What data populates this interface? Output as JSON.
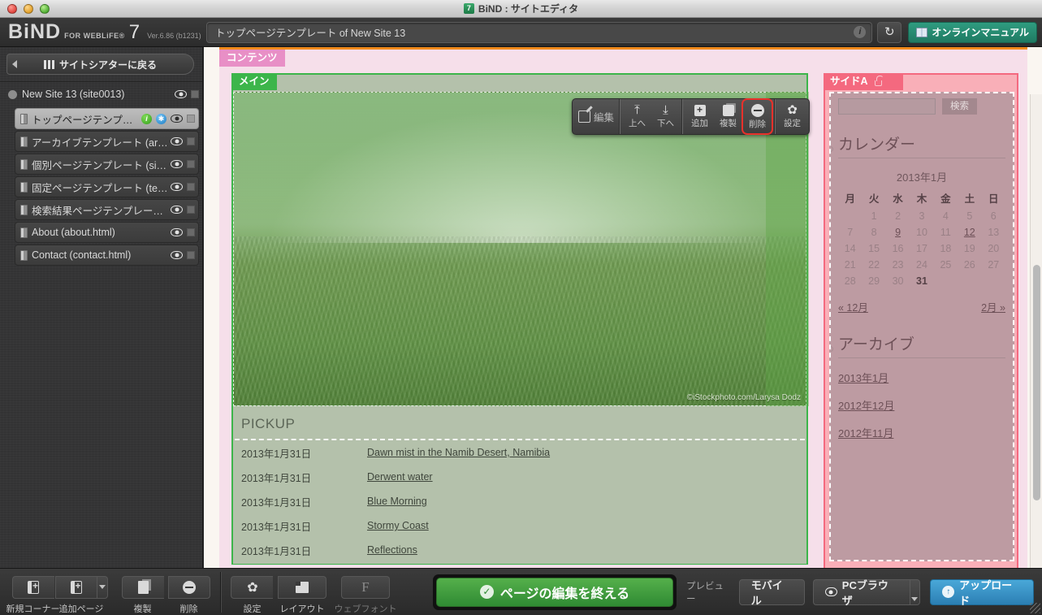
{
  "window": {
    "title": "BiND : サイトエディタ",
    "app_badge": "7"
  },
  "toolbar": {
    "brand_name": "BiND",
    "brand_sub": "FOR WEBLiFE®",
    "brand_version_num": "7",
    "version_text": "Ver.6.86 (b1231)",
    "address_value": "トップページテンプレート of New Site 13",
    "info_icon": "i",
    "reload_icon": "↻",
    "manual_label": "オンラインマニュアル"
  },
  "sidebar": {
    "back_label": "サイトシアターに戻る",
    "root": {
      "label": "New Site 13 (site0013)"
    },
    "items": [
      {
        "label": "トップページテンプレー...",
        "selected": true,
        "has_info": true,
        "has_gear": true
      },
      {
        "label": "アーカイブテンプレート (archiv...",
        "selected": false,
        "has_info": false,
        "has_gear": false
      },
      {
        "label": "個別ページテンプレート (single...",
        "selected": false,
        "has_info": false,
        "has_gear": false
      },
      {
        "label": "固定ページテンプレート (templ...",
        "selected": false,
        "has_info": false,
        "has_gear": false
      },
      {
        "label": "検索結果ページテンプレート (s...",
        "selected": false,
        "has_info": false,
        "has_gear": false
      },
      {
        "label": "About (about.html)",
        "selected": false,
        "has_info": false,
        "has_gear": false
      },
      {
        "label": "Contact (contact.html)",
        "selected": false,
        "has_info": false,
        "has_gear": false
      }
    ]
  },
  "canvas": {
    "tag_contents": "コンテンツ",
    "tag_main": "メイン",
    "tag_sidea": "サイドA",
    "hero_credit": "©iStockphoto.com/Larysa Dodz",
    "block_toolbar": {
      "edit": "編集",
      "up": "上へ",
      "down": "下へ",
      "add": "追加",
      "duplicate": "複製",
      "delete": "削除",
      "settings": "設定",
      "highlight_color": "#e8312b"
    },
    "pickup": {
      "heading": "PICKUP",
      "rows": [
        {
          "date": "2013年1月31日",
          "title": "Dawn mist in the Namib Desert, Namibia"
        },
        {
          "date": "2013年1月31日",
          "title": "Derwent water"
        },
        {
          "date": "2013年1月31日",
          "title": "Blue Morning"
        },
        {
          "date": "2013年1月31日",
          "title": "Stormy Coast"
        },
        {
          "date": "2013年1月31日",
          "title": "Reflections"
        }
      ]
    },
    "side_widget": {
      "search_value": "",
      "search_button": "検索",
      "calendar_heading": "カレンダー",
      "calendar_title": "2013年1月",
      "weekdays": [
        "月",
        "火",
        "水",
        "木",
        "金",
        "土",
        "日"
      ],
      "weeks": [
        [
          {
            "d": ""
          },
          {
            "d": "1"
          },
          {
            "d": "2"
          },
          {
            "d": "3"
          },
          {
            "d": "4"
          },
          {
            "d": "5"
          },
          {
            "d": "6"
          }
        ],
        [
          {
            "d": "7"
          },
          {
            "d": "8"
          },
          {
            "d": "9",
            "link": true
          },
          {
            "d": "10"
          },
          {
            "d": "11"
          },
          {
            "d": "12",
            "link": true
          },
          {
            "d": "13"
          }
        ],
        [
          {
            "d": "14"
          },
          {
            "d": "15"
          },
          {
            "d": "16"
          },
          {
            "d": "17"
          },
          {
            "d": "18"
          },
          {
            "d": "19"
          },
          {
            "d": "20"
          }
        ],
        [
          {
            "d": "21"
          },
          {
            "d": "22"
          },
          {
            "d": "23"
          },
          {
            "d": "24"
          },
          {
            "d": "25"
          },
          {
            "d": "26"
          },
          {
            "d": "27"
          }
        ],
        [
          {
            "d": "28"
          },
          {
            "d": "29"
          },
          {
            "d": "30"
          },
          {
            "d": "31",
            "bold": true
          },
          {
            "d": ""
          },
          {
            "d": ""
          },
          {
            "d": ""
          }
        ]
      ],
      "prev_month": "« 12月",
      "next_month": "2月 »",
      "archive_heading": "アーカイブ",
      "archive_links": [
        "2013年1月",
        "2012年12月",
        "2012年11月"
      ]
    }
  },
  "bottombar": {
    "new_corner": "新規コーナー",
    "add_page": "追加ページ",
    "duplicate": "複製",
    "delete": "削除",
    "settings": "設定",
    "layout": "レイアウト",
    "webfont": "ウェブフォント",
    "webfont_glyph": "F",
    "finish_label": "ページの編集を終える",
    "preview_label": "プレビュー",
    "mobile_label": "モバイル",
    "pcbrowser_label": "PCブラウザ",
    "upload_label": "アップロード"
  }
}
